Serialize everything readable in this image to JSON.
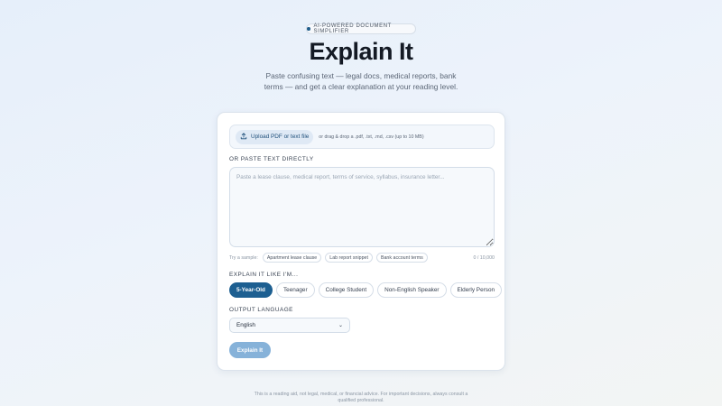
{
  "badge": {
    "label": "AI-POWERED DOCUMENT SIMPLIFIER"
  },
  "header": {
    "title": "Explain It",
    "subtitle": "Paste confusing text — legal docs, medical reports, bank terms — and get a clear explanation at your reading level."
  },
  "upload": {
    "button_label": "Upload PDF or text file",
    "hint": "or drag & drop a .pdf, .txt, .md, .csv (up to 10 MB)",
    "icon": "upload-icon"
  },
  "paste": {
    "label": "OR PASTE TEXT DIRECTLY",
    "placeholder": "Paste a lease clause, medical report, terms of service, syllabus, insurance letter...",
    "value": ""
  },
  "samples": {
    "label": "Try a sample:",
    "items": [
      "Apartment lease clause",
      "Lab report snippet",
      "Bank account terms"
    ]
  },
  "char_count": "0 / 10,000",
  "levels": {
    "label": "EXPLAIN IT LIKE I'M...",
    "items": [
      "5-Year-Old",
      "Teenager",
      "College Student",
      "Non-English Speaker",
      "Elderly Person"
    ],
    "selected": "5-Year-Old"
  },
  "language": {
    "label": "OUTPUT LANGUAGE",
    "selected": "English"
  },
  "submit": {
    "label": "Explain It"
  },
  "disclaimer": "This is a reading aid, not legal, medical, or financial advice. For important decisions, always consult a qualified professional.",
  "colors": {
    "accent": "#1d5f91",
    "button_disabled": "#86b2d9",
    "text_primary": "#141a24",
    "text_muted": "#5b6676"
  }
}
